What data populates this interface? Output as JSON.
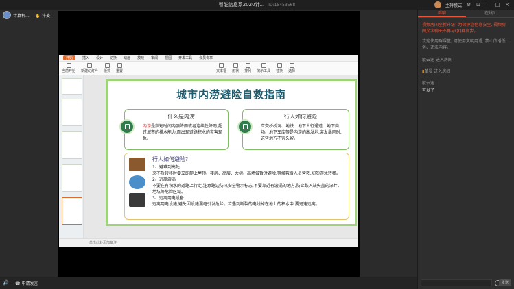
{
  "window": {
    "title": "智能信息系2020计...",
    "room_id": "ID:15453568",
    "host_label": "主持模式"
  },
  "user": {
    "name": "计算机...",
    "raise_hand": "排麦"
  },
  "ppt": {
    "menus": [
      "开始",
      "插入",
      "设计",
      "切换",
      "动画",
      "放映",
      "审阅",
      "视图",
      "开发工具",
      "会员专享"
    ],
    "active_menu": "开始",
    "tools": [
      "当前开始",
      "新建幻灯片",
      "版式",
      "重置",
      "文本框",
      "形状",
      "排列",
      "演示工具",
      "替换",
      "选择"
    ],
    "status_text": "单击此处添加备注"
  },
  "slide": {
    "title": "城市内涝避险自救指南",
    "card_left": {
      "heading": "什么是内涝",
      "highlight": "内涝",
      "body": "是指短时间内强降雨或者连续性降雨,超过城市的排水能力,而出现道路积水的灾害现象。"
    },
    "card_right": {
      "heading": "行人如何避险",
      "body": "立交桥桥洞、地铁、地下人行通道、地下商场、地下车库等是内涝的高发地,突发暴雨时,这些地方不宜久留。"
    },
    "card_bottom": {
      "heading": "行人如何避险?",
      "items": [
        "1、避难到高处",
        "来不及转移时要立即爬上屋顶、楼房、高层、大树、高墙做暂时避险,等候救援人员营救,切勿游泳转移。",
        "2、远离漩涡",
        "不要在有积水的道路上行走,注意路边防汛安全警示标志,不要靠近有漩涡的地方,防止跌入缺失盖的深井、地坑等危险区域。",
        "3、远离用电设备",
        "远离用电设施,避免因设施漏电引发危险。若遇到断裂的电线掉在地上的积水中,要迅速远离。"
      ]
    }
  },
  "bottom": {
    "apply_label": "申请发言"
  },
  "panel": {
    "tabs": [
      "群聊",
      "在线1"
    ],
    "active_tab": "群聊",
    "system_msg": "视频房间全新升级! 为保护您信息安全, 视频房间文字聊天不再与QQ群同步。",
    "notice_msg": "欢迎使用群课堂, 请使用文明用语, 禁止传播低俗、违法内容。",
    "messages": [
      {
        "user": "耿云涵",
        "enter": "进入房间"
      },
      {
        "user": "单曼",
        "enter": "进入房间"
      },
      {
        "user": "耿云涵",
        "text": "可以了"
      }
    ],
    "send_label": "发送"
  },
  "colors": {
    "accent": "#e8563b",
    "slide_border": "#9fd37a",
    "slide_title": "#1d5c6e"
  }
}
